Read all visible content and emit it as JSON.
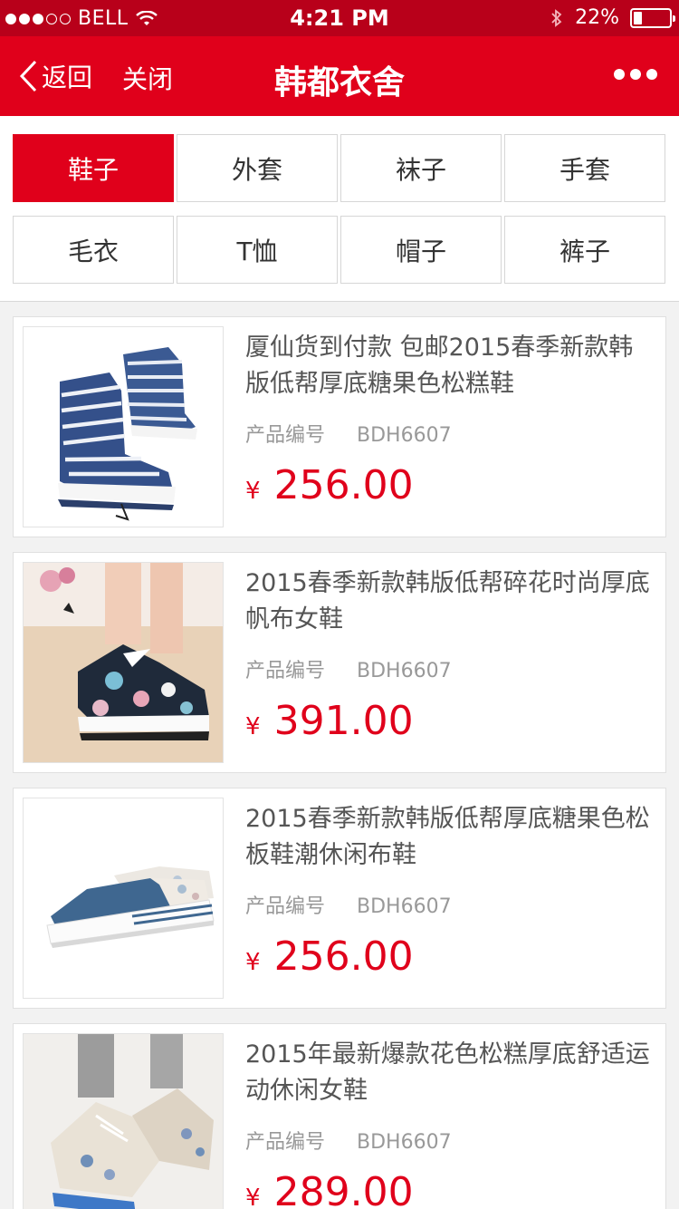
{
  "status_bar": {
    "carrier": "BELL",
    "time": "4:21 PM",
    "battery": "22%"
  },
  "nav": {
    "back_label": "返回",
    "close_label": "关闭",
    "title": "韩都衣舍"
  },
  "categories": [
    {
      "label": "鞋子",
      "active": true
    },
    {
      "label": "外套",
      "active": false
    },
    {
      "label": "袜子",
      "active": false
    },
    {
      "label": "手套",
      "active": false
    },
    {
      "label": "毛衣",
      "active": false
    },
    {
      "label": "T恤",
      "active": false
    },
    {
      "label": "帽子",
      "active": false
    },
    {
      "label": "裤子",
      "active": false
    }
  ],
  "products": [
    {
      "title": "厦仙货到付款 包邮2015春季新款韩版低帮厚底糖果色松糕鞋",
      "code_label": "产品编号",
      "code": "BDH6607",
      "currency": "¥",
      "price": "256.00"
    },
    {
      "title": "2015春季新款韩版低帮碎花时尚厚底帆布女鞋",
      "code_label": "产品编号",
      "code": "BDH6607",
      "currency": "¥",
      "price": "391.00"
    },
    {
      "title": "2015春季新款韩版低帮厚底糖果色松板鞋潮休闲布鞋",
      "code_label": "产品编号",
      "code": "BDH6607",
      "currency": "¥",
      "price": "256.00"
    },
    {
      "title": "2015年最新爆款花色松糕厚底舒适运动休闲女鞋",
      "code_label": "产品编号",
      "code": "BDH6607",
      "currency": "¥",
      "price": "289.00"
    }
  ],
  "colors": {
    "brand_red": "#e0001b",
    "status_red": "#b8001a"
  }
}
